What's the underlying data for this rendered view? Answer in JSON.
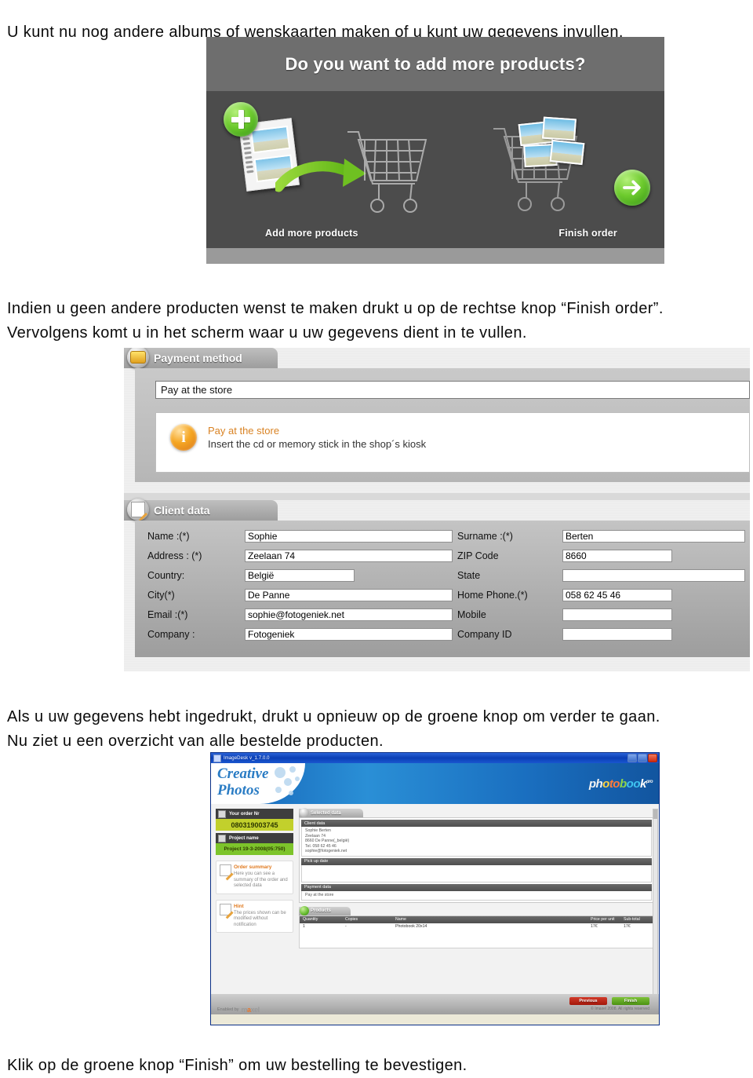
{
  "paragraphs": {
    "intro": "U kunt nu nog andere albums of wenskaarten maken of u kunt uw gegevens invullen.",
    "middle": "Indien u geen andere producten wenst te maken drukt u op de rechtse knop “Finish order”.\nVervolgens komt u in het scherm waar u uw gegevens dient in te vullen.",
    "after_form": "Als u uw gegevens hebt ingedrukt, drukt u opnieuw op de groene knop om verder te gaan.\nNu ziet u een overzicht van alle bestelde producten.",
    "final": "Klik op de groene knop “Finish” om uw bestelling te bevestigen."
  },
  "figure_addmore": {
    "heading": "Do you want to add more products?",
    "left_label": "Add more products",
    "right_label": "Finish order"
  },
  "figure_form": {
    "payment_panel": {
      "tab_label": "Payment method",
      "selected_method": "Pay at the store",
      "info_title": "Pay at the store",
      "info_text": "Insert the cd or memory stick in the shop´s kiosk"
    },
    "client_panel": {
      "tab_label": "Client data",
      "fields": [
        {
          "label": "Name :(*)",
          "value": "Sophie",
          "size": "full"
        },
        {
          "label": "Surname :(*)",
          "value": "Berten",
          "size": "full"
        },
        {
          "label": "Address : (*)",
          "value": "Zeelaan 74",
          "size": "full"
        },
        {
          "label": "ZIP Code",
          "value": "8660",
          "size": "md"
        },
        {
          "label": "Country:",
          "value": "België",
          "size": "md"
        },
        {
          "label": "State",
          "value": "",
          "size": "full"
        },
        {
          "label": "City(*)",
          "value": "De Panne",
          "size": "full"
        },
        {
          "label": "Home Phone.(*)",
          "value": "058 62 45 46",
          "size": "md"
        },
        {
          "label": "Email :(*)",
          "value": "sophie@fotogeniek.net",
          "size": "full"
        },
        {
          "label": "Mobile",
          "value": "",
          "size": "md"
        },
        {
          "label": "Company :",
          "value": "Fotogeniek",
          "size": "full"
        },
        {
          "label": "Company ID",
          "value": "",
          "size": "md"
        }
      ]
    }
  },
  "figure_app": {
    "window_title": "ImageDesk v_1.7.0.0",
    "brand_line1": "Creative",
    "brand_line2": "Photos",
    "product_logo": {
      "p1": "ph",
      "p2": "o",
      "p3": "to",
      "p4": "b",
      "p5": "oo",
      "p6": "k",
      "sup": "pro"
    },
    "sidebar": {
      "order_nr_label": "Your order Nr",
      "order_nr_value": "080319003745",
      "project_label": "Project name",
      "project_value": "Project 19-3-2008(05:750)",
      "hints": [
        {
          "title": "Order summary",
          "body": "Here you can see a summary of the order and selected data"
        },
        {
          "title": "Hint",
          "body": "The prices shown can be modified without notification"
        }
      ]
    },
    "selected_data": {
      "tab_label": "Selected data",
      "sections": [
        {
          "title": "Client data",
          "lines": [
            "Sophie Berten",
            "Zeelaan 74",
            "8660 De Panne(_belgië)",
            "Tel. 058 62 45 46",
            "sophie@fotogeniek.net"
          ]
        },
        {
          "title": "Pick up date",
          "lines": []
        },
        {
          "title": "Payment data",
          "lines": [
            "Pay at the store"
          ]
        }
      ]
    },
    "products": {
      "tab_label": "Products",
      "columns": [
        "Quantity",
        "Copies",
        "Name",
        "Price per unit",
        "Sub-total"
      ],
      "rows": [
        {
          "quantity": "1",
          "copies": "-",
          "name": "Photobook 20x14",
          "price_per_unit": "17€",
          "sub_total": "17€"
        }
      ]
    },
    "footer": {
      "previous_label": "Previous",
      "finish_label": "Finish",
      "copyright": "© Imaxel 2008. All rights reserved",
      "enabled_by": "Enabled by",
      "vendor": "maxel"
    }
  },
  "colors": {
    "green_accent": "#63b92c",
    "red_button": "#a4170a",
    "orange_info": "#f5a623",
    "olive_badge": "#c2d02c",
    "blue_titlebar": "#0b3fb5"
  }
}
